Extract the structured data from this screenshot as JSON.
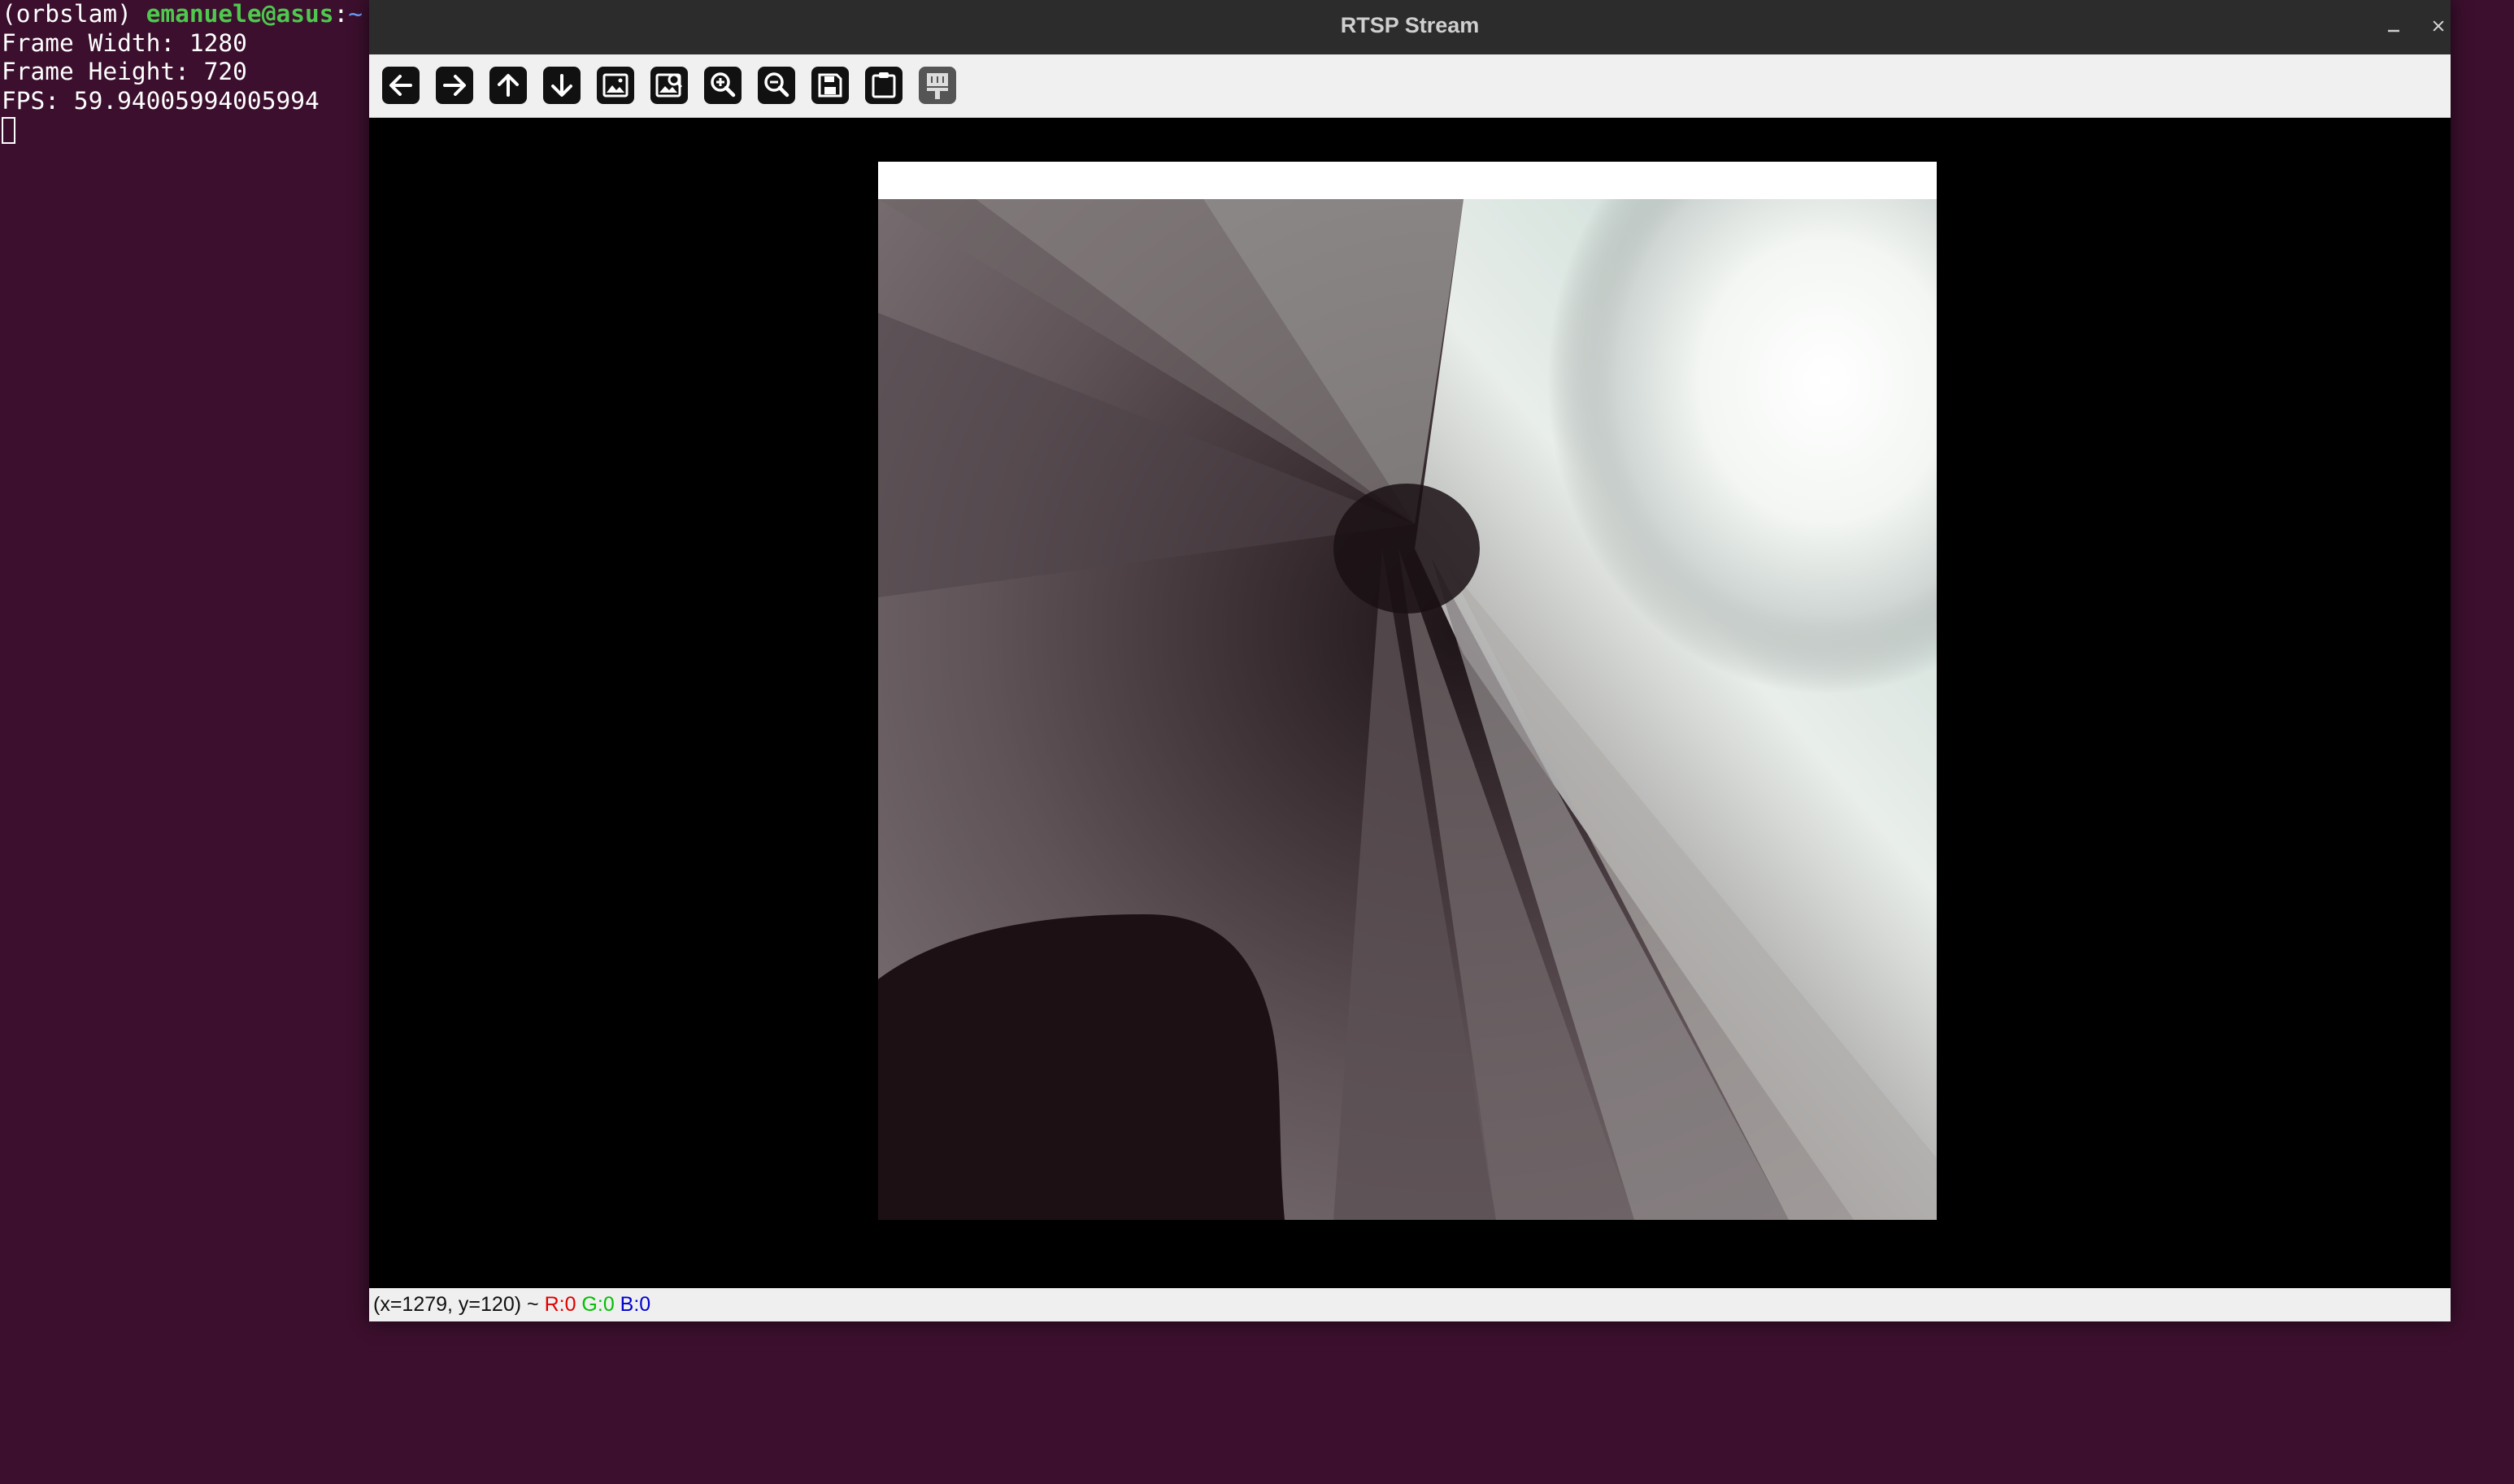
{
  "terminal": {
    "prompt_env": "(orbslam) ",
    "prompt_user": "emanuele@asus",
    "prompt_sep": ":~",
    "lines": [
      "Frame Width: 1280",
      "Frame Height: 720",
      "FPS: 59.94005994005994"
    ]
  },
  "window": {
    "title": "RTSP Stream",
    "controls": {
      "minimize_icon": "minimize-icon",
      "close_icon": "close-icon"
    }
  },
  "toolbar": {
    "buttons": [
      {
        "icon": "arrow-left-icon"
      },
      {
        "icon": "arrow-right-icon"
      },
      {
        "icon": "arrow-up-icon"
      },
      {
        "icon": "arrow-down-icon"
      },
      {
        "icon": "image-icon"
      },
      {
        "icon": "image-zoom-icon"
      },
      {
        "icon": "zoom-in-icon"
      },
      {
        "icon": "zoom-out-icon"
      },
      {
        "icon": "save-icon"
      },
      {
        "icon": "clipboard-icon"
      },
      {
        "icon": "properties-icon"
      }
    ]
  },
  "statusbar": {
    "coords": "(x=1279, y=120) ~ ",
    "r": "R:0",
    "g": "G:0",
    "b": "B:0"
  },
  "colors": {
    "desktop": "#3b0f2d",
    "titlebar": "#2c2c2c",
    "toolbar": "#f0f0f0",
    "status_r": "#e00000",
    "status_g": "#00c000",
    "status_b": "#0000d0"
  }
}
